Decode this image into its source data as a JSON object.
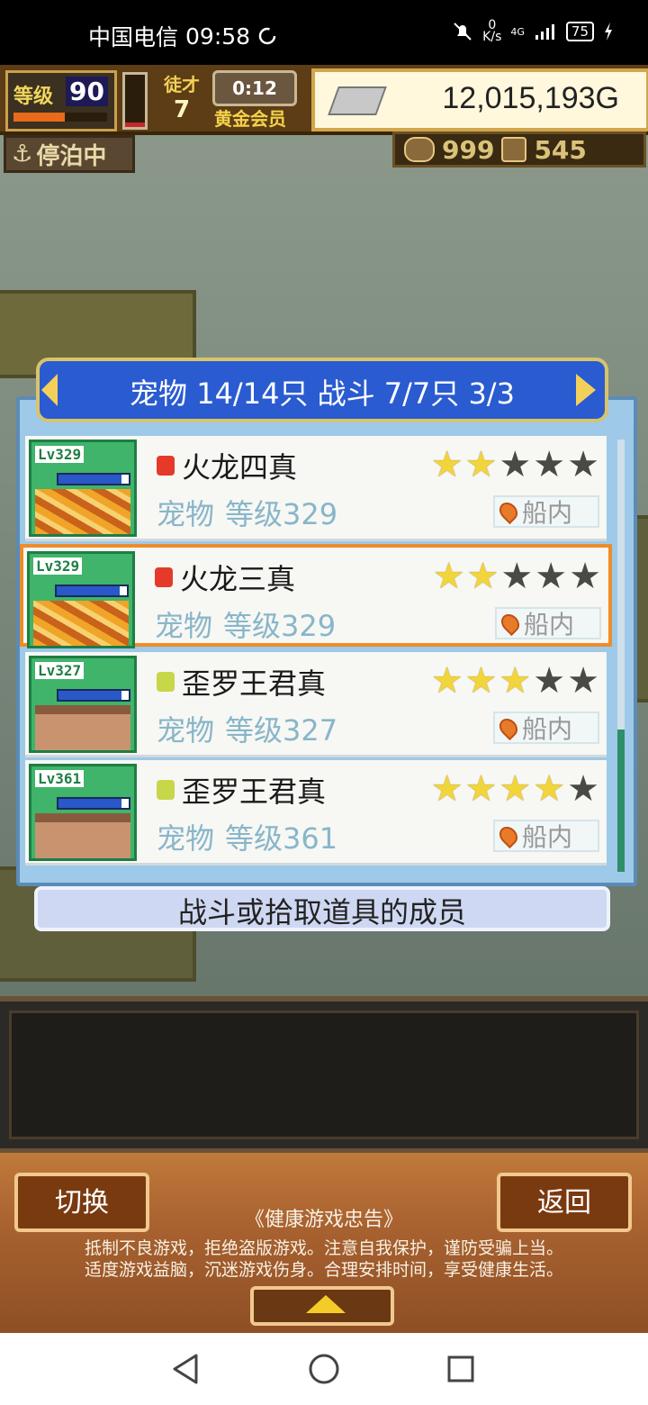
{
  "status_bar": {
    "carrier": "中国电信",
    "time": "09:58",
    "net_speed_value": "0",
    "net_speed_unit": "K/s",
    "signal_label": "4G",
    "battery": "75"
  },
  "hud": {
    "level_label": "等级",
    "level_value": "90",
    "vip_label": "徒才",
    "vip_value": "7",
    "timer": "0:12",
    "member_label": "黄金会员",
    "money": "12,015,193G",
    "anchor_status": "停泊中",
    "resource_a": "999",
    "resource_b": "545"
  },
  "panel": {
    "header": "宠物 14/14只 战斗 7/7只  3/3",
    "rows": [
      {
        "lv": "Lv329",
        "name": "火龙四真",
        "type": "宠物",
        "level_text": "等级329",
        "stars": 2,
        "location": "船内",
        "element": "fire",
        "art": "dragon"
      },
      {
        "lv": "Lv329",
        "name": "火龙三真",
        "type": "宠物",
        "level_text": "等级329",
        "stars": 2,
        "location": "船内",
        "element": "fire",
        "art": "dragon"
      },
      {
        "lv": "Lv327",
        "name": "歪罗王君真",
        "type": "宠物",
        "level_text": "等级327",
        "stars": 3,
        "location": "船内",
        "element": "sun",
        "art": "king"
      },
      {
        "lv": "Lv361",
        "name": "歪罗王君真",
        "type": "宠物",
        "level_text": "等级361",
        "stars": 4,
        "location": "船内",
        "element": "sun",
        "art": "king"
      }
    ],
    "selected_index": 1,
    "info": "战斗或拾取道具的成员"
  },
  "footer": {
    "switch_label": "切换",
    "back_label": "返回",
    "notice_title": "《健康游戏忠告》",
    "notice_line1": "抵制不良游戏，拒绝盗版游戏。注意自我保护，谨防受骗上当。",
    "notice_line2": "适度游戏益脑，沉迷游戏伤身。合理安排时间，享受健康生活。"
  },
  "levels": {
    "xp_fraction": 0.55,
    "red_gauge_fraction": 0.08,
    "scroll_thumb_fraction": 0.33
  },
  "colors": {
    "accent_blue": "#2a5bd0",
    "select_orange": "#ee8c2a",
    "star_on": "#f2d43b"
  }
}
